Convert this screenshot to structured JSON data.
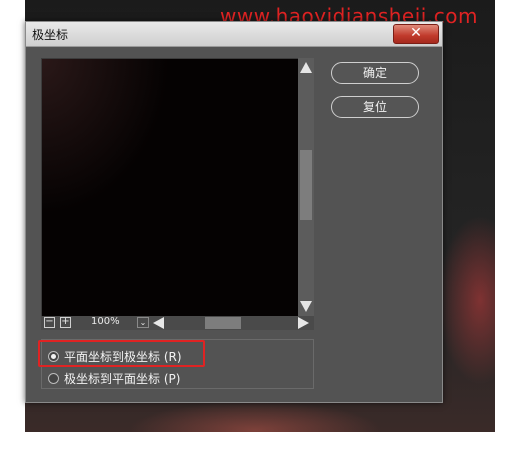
{
  "watermark": "www.haoyidiansheji.com",
  "dialog": {
    "title": "极坐标",
    "close_icon": "close-icon"
  },
  "buttons": {
    "ok": "确定",
    "reset": "复位"
  },
  "zoom": {
    "minus": "−",
    "plus": "+",
    "value": "100%",
    "dropdown": "⌄"
  },
  "options": [
    {
      "label": "平面坐标到极坐标 (R)",
      "selected": true
    },
    {
      "label": "极坐标到平面坐标 (P)",
      "selected": false
    }
  ],
  "colors": {
    "highlight": "#e02323",
    "watermark": "#e02323",
    "close_button": "#c0392b"
  }
}
